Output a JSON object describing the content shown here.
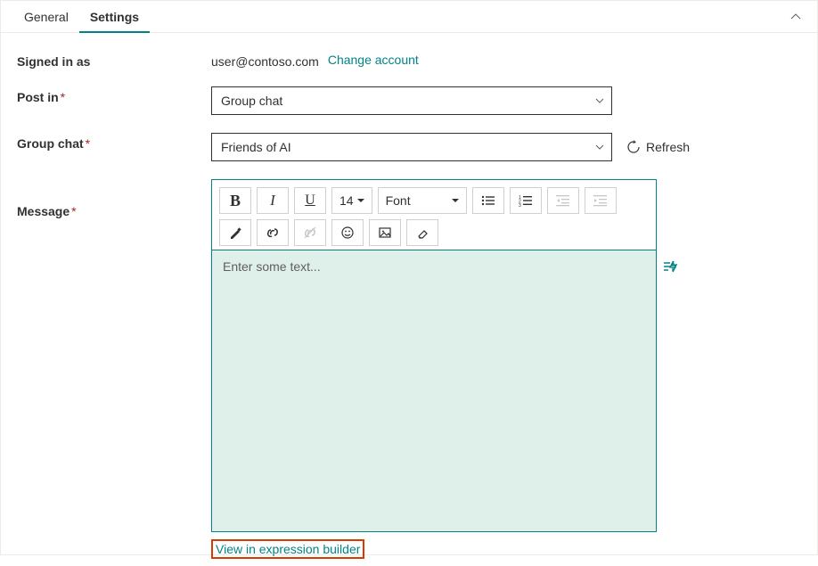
{
  "tabs": {
    "general": "General",
    "settings": "Settings"
  },
  "fields": {
    "signed_in_label": "Signed in as",
    "signed_in_value": "user@contoso.com",
    "change_account": "Change account",
    "post_in_label": "Post in",
    "post_in_value": "Group chat",
    "group_chat_label": "Group chat",
    "group_chat_value": "Friends of AI",
    "refresh": "Refresh",
    "message_label": "Message"
  },
  "editor": {
    "placeholder": "Enter some text...",
    "font_size": "14",
    "font_label": "Font"
  },
  "links": {
    "expression_builder": "View in expression builder"
  }
}
